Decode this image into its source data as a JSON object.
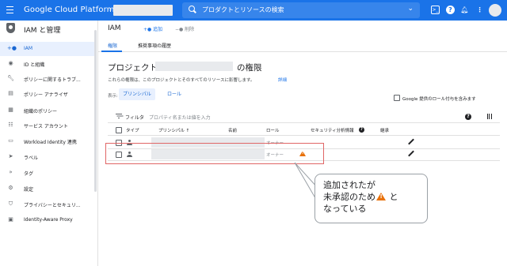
{
  "topbar": {
    "brand": "Google Cloud Platform",
    "search_placeholder": "プロダクトとリソースの検索"
  },
  "sidebar": {
    "title": "IAM と管理",
    "items": [
      {
        "label": "IAM",
        "icon": "person-add-icon",
        "active": true
      },
      {
        "label": "ID と組織",
        "icon": "account-circle-icon"
      },
      {
        "label": "ポリシーに関するトラブ...",
        "icon": "wrench-icon"
      },
      {
        "label": "ポリシー アナライザ",
        "icon": "analyzer-icon"
      },
      {
        "label": "組織のポリシー",
        "icon": "policy-icon"
      },
      {
        "label": "サービス アカウント",
        "icon": "service-account-icon"
      },
      {
        "label": "Workload Identity 連携",
        "icon": "workload-identity-icon"
      },
      {
        "label": "ラベル",
        "icon": "label-icon"
      },
      {
        "label": "タグ",
        "icon": "tag-icon"
      },
      {
        "label": "設定",
        "icon": "settings-icon"
      },
      {
        "label": "プライバシーとセキュリ...",
        "icon": "privacy-icon"
      },
      {
        "label": "Identity-Aware Proxy",
        "icon": "iap-icon"
      }
    ]
  },
  "header": {
    "title": "IAM",
    "add_label": "追加",
    "remove_label": "削除"
  },
  "tabs": [
    {
      "label": "権限",
      "active": true
    },
    {
      "label": "推奨事項の履歴",
      "active": false
    }
  ],
  "content": {
    "heading_prefix": "プロジェクト",
    "heading_suffix": "の権限",
    "description": "これらの権限は、このプロジェクトとそのすべてのリソースに影響します。",
    "details_link": "詳細",
    "view_label": "表示:",
    "view_principals": "プリンシパル",
    "view_roles": "ロール",
    "google_provided_label": "Google 提供のロール付与を含みます",
    "filter_label": "フィルタ",
    "filter_placeholder": "プロパティ名または値を入力"
  },
  "table": {
    "columns": {
      "type": "タイプ",
      "principal": "プリンシパル",
      "name": "名前",
      "role": "ロール",
      "security_insights": "セキュリティ分析情報",
      "inheritance": "継承"
    },
    "rows": [
      {
        "role": "オーナー",
        "warning": false
      },
      {
        "role": "オーナー",
        "warning": true
      }
    ]
  },
  "callout": {
    "line1": "追加されたが",
    "line2_before": "未承認のため",
    "line2_after": "と",
    "line3": "なっている"
  },
  "colors": {
    "topbar": "#1a73e8",
    "accent": "#1967d2",
    "warning": "#e8710a",
    "highlight_border": "#e06666"
  }
}
